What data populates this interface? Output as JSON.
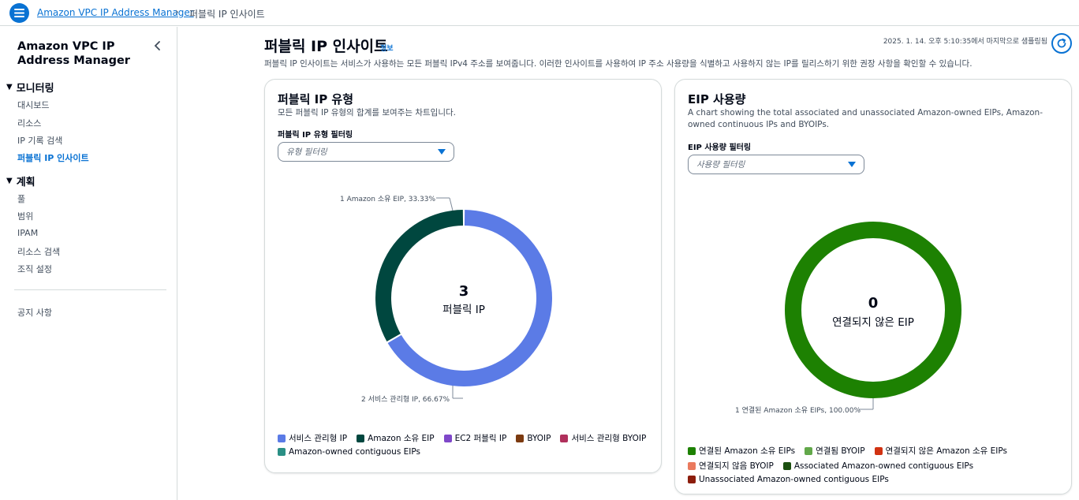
{
  "breadcrumb": {
    "service_link": "Amazon VPC IP Address Manager",
    "current": "퍼블릭 IP 인사이트"
  },
  "sidebar": {
    "title": "Amazon VPC IP Address Manager",
    "sections": [
      {
        "label": "모니터링",
        "items": [
          "대시보드",
          "리소스",
          "IP 기록 검색",
          "퍼블릭 IP 인사이트"
        ]
      },
      {
        "label": "계획",
        "items": [
          "풀",
          "범위",
          "IPAM",
          "리소스 검색",
          "조직 설정"
        ]
      }
    ],
    "footer_item": "공지 사항",
    "active_item": "퍼블릭 IP 인사이트"
  },
  "header": {
    "title": "퍼블릭 IP 인사이트",
    "info": "정보",
    "description": "퍼블릭 IP 인사이트는 서비스가 사용하는 모든 퍼블릭 IPv4 주소를 보여줍니다. 이러한 인사이트를 사용하여 IP 주소 사용량을 식별하고 사용하지 않는 IP를 릴리스하기 위한 권장 사항을 확인할 수 있습니다.",
    "last_sampled": "2025. 1. 14. 오후 5:10:35에서 마지막으로 샘플링됨",
    "refresh_icon": "refresh-icon"
  },
  "cards": {
    "public_ip_types": {
      "title": "퍼블릭 IP 유형",
      "description": "모든 퍼블릭 IP 유형의 합계를 보여주는 차트입니다.",
      "filter_label": "퍼블릭 IP 유형 필터링",
      "filter_placeholder": "유형 필터링",
      "center_value": "3",
      "center_label": "퍼블릭 IP",
      "callout_top": "1 Amazon 소유 EIP, 33.33%",
      "callout_bottom": "2 서비스 관리형 IP, 66.67%",
      "legend": [
        {
          "label": "서비스 관리형 IP",
          "color": "#5b7be6"
        },
        {
          "label": "Amazon 소유 EIP",
          "color": "#00473f"
        },
        {
          "label": "EC2 퍼블릭 IP",
          "color": "#7f48c9"
        },
        {
          "label": "BYOIP",
          "color": "#7c3a10"
        },
        {
          "label": "서비스 관리형 BYOIP",
          "color": "#b0305c"
        },
        {
          "label": "Amazon-owned contiguous EIPs",
          "color": "#2a8f85"
        }
      ]
    },
    "eip_usage": {
      "title": "EIP 사용량",
      "description": "A chart showing the total associated and unassociated Amazon-owned EIPs, Amazon-owned continuous IPs and BYOIPs.",
      "filter_label": "EIP 사용량 필터링",
      "filter_placeholder": "사용량 필터링",
      "center_value": "0",
      "center_label": "연결되지 않은 EIP",
      "callout_bottom": "1 연결된 Amazon 소유 EIPs, 100.00%",
      "legend": [
        {
          "label": "연결된 Amazon 소유 EIPs",
          "color": "#1d8102"
        },
        {
          "label": "연결됨 BYOIP",
          "color": "#62a84a"
        },
        {
          "label": "연결되지 않은 Amazon 소유 EIPs",
          "color": "#d13212"
        },
        {
          "label": "연결되지 않음 BYOIP",
          "color": "#ea7a5e"
        },
        {
          "label": "Associated Amazon-owned contiguous EIPs",
          "color": "#1b4f0f"
        },
        {
          "label": "Unassociated Amazon-owned contiguous EIPs",
          "color": "#8c1d0c"
        }
      ]
    }
  },
  "chart_data": [
    {
      "type": "pie",
      "categories": [
        "서비스 관리형 IP",
        "Amazon 소유 EIP",
        "EC2 퍼블릭 IP",
        "BYOIP",
        "서비스 관리형 BYOIP",
        "Amazon-owned contiguous EIPs"
      ],
      "values": [
        2,
        1,
        0,
        0,
        0,
        0
      ],
      "colors": [
        "#5b7be6",
        "#00473f",
        "#7f48c9",
        "#7c3a10",
        "#b0305c",
        "#2a8f85"
      ],
      "title": "퍼블릭 IP 유형",
      "total": 3,
      "legend": "bottom"
    },
    {
      "type": "pie",
      "categories": [
        "연결된 Amazon 소유 EIPs",
        "연결됨 BYOIP",
        "연결되지 않은 Amazon 소유 EIPs",
        "연결되지 않음 BYOIP",
        "Associated Amazon-owned contiguous EIPs",
        "Unassociated Amazon-owned contiguous EIPs"
      ],
      "values": [
        1,
        0,
        0,
        0,
        0,
        0
      ],
      "colors": [
        "#1d8102",
        "#62a84a",
        "#d13212",
        "#ea7a5e",
        "#1b4f0f",
        "#8c1d0c"
      ],
      "title": "EIP 사용량",
      "total": 0,
      "legend": "bottom"
    }
  ]
}
